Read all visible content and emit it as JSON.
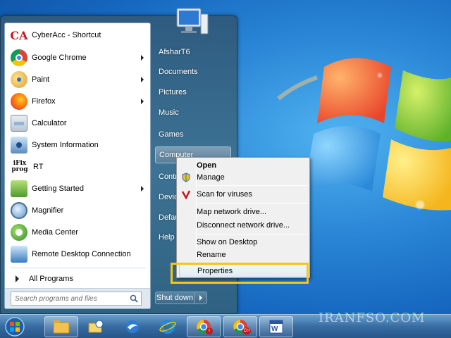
{
  "start_menu": {
    "programs": [
      {
        "label": "CyberAcc - Shortcut",
        "icon": "cyberacc-icon",
        "has_submenu": false
      },
      {
        "label": "Google Chrome",
        "icon": "chrome-icon",
        "has_submenu": true
      },
      {
        "label": "Paint",
        "icon": "paint-icon",
        "has_submenu": true
      },
      {
        "label": "Firefox",
        "icon": "firefox-icon",
        "has_submenu": true
      },
      {
        "label": "Calculator",
        "icon": "calculator-icon",
        "has_submenu": false
      },
      {
        "label": "System Information",
        "icon": "system-information-icon",
        "has_submenu": false
      },
      {
        "label": "RT",
        "icon": "ifix-prog-icon",
        "has_submenu": false
      },
      {
        "label": "Getting Started",
        "icon": "getting-started-icon",
        "has_submenu": true
      },
      {
        "label": "Magnifier",
        "icon": "magnifier-icon",
        "has_submenu": false
      },
      {
        "label": "Media Center",
        "icon": "media-center-icon",
        "has_submenu": false
      },
      {
        "label": "Remote Desktop Connection",
        "icon": "remote-desktop-icon",
        "has_submenu": false
      }
    ],
    "ifix_logo_text": "iFix prog",
    "cyberacc_logo_text": "CA",
    "all_programs_label": "All Programs",
    "search_placeholder": "Search programs and files",
    "right_items": [
      {
        "label": "AfsharT6"
      },
      {
        "label": "Documents"
      },
      {
        "label": "Pictures"
      },
      {
        "label": "Music"
      },
      {
        "label": "Games"
      },
      {
        "label": "Computer"
      },
      {
        "label": "Contr"
      },
      {
        "label": "Devic"
      },
      {
        "label": "Defau"
      },
      {
        "label": "Help a"
      }
    ],
    "shutdown_label": "Shut down"
  },
  "context_menu": {
    "items": [
      {
        "label": "Open",
        "bold": true
      },
      {
        "label": "Manage"
      },
      {
        "label": "Scan for viruses"
      },
      {
        "label": "Map network drive..."
      },
      {
        "label": "Disconnect network drive..."
      },
      {
        "label": "Show on Desktop"
      },
      {
        "label": "Rename"
      },
      {
        "label": "Properties",
        "highlighted": true
      }
    ]
  },
  "taskbar": {
    "chrome_badge_1": "i",
    "chrome_badge_2": "CH",
    "word_badge": "W"
  },
  "watermark": "IRANFSO.COM",
  "colors": {
    "highlight_border": "#f5c518",
    "start_menu_bg": "#2e5b7f",
    "desktop_bg": "#1a72c8"
  }
}
